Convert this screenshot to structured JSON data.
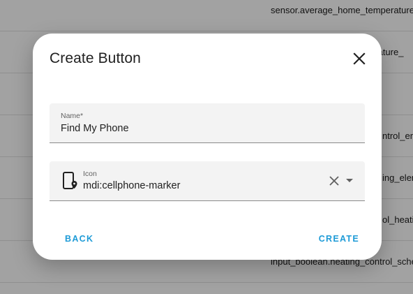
{
  "background": {
    "rows": [
      "sensor.average_home_temperature",
      "erature_",
      "",
      "ntrol_end_",
      "ing_elem",
      "ol_heati",
      "input_boolean.heating_control_sche"
    ]
  },
  "dialog": {
    "title": "Create Button",
    "close_icon": "close-icon",
    "name_field": {
      "label": "Name*",
      "value": "Find My Phone"
    },
    "icon_field": {
      "label": "Icon",
      "value": "mdi:cellphone-marker",
      "leading_icon": "cellphone-marker-icon",
      "clear_icon": "clear-icon",
      "dropdown_icon": "dropdown-arrow-icon"
    },
    "actions": {
      "back": "BACK",
      "create": "CREATE"
    },
    "accent_color": "#1e9bd7"
  }
}
